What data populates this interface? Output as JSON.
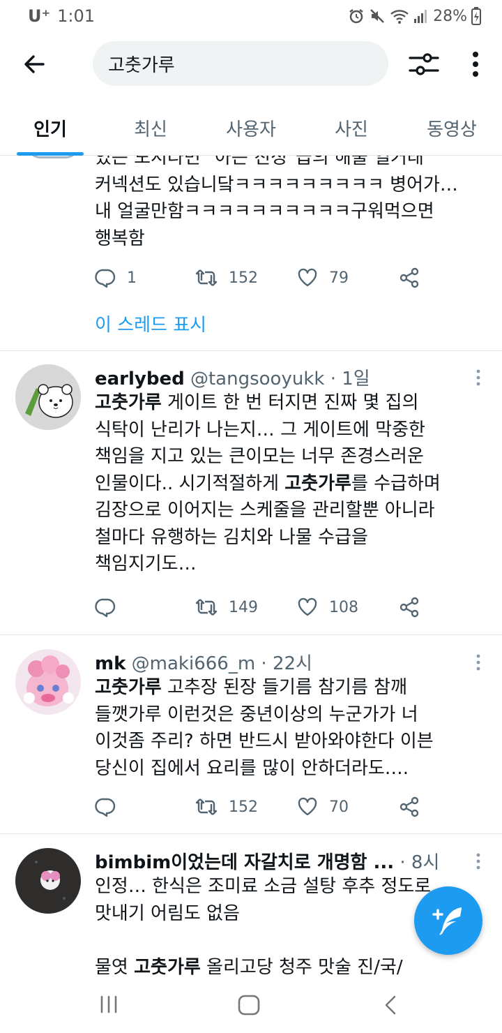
{
  "status_bar": {
    "carrier": "U⁺",
    "time": "1:01",
    "battery": "28%",
    "icons": [
      "alarm-icon",
      "mute-icon",
      "wifi-icon",
      "signal-icon",
      "battery-charging-icon"
    ]
  },
  "search": {
    "query": "고춧가루",
    "back_icon": "arrow-left-icon",
    "filter_icon": "filter-sliders-icon",
    "more_icon": "more-vertical-icon"
  },
  "tabs": [
    {
      "label": "인기",
      "active": true
    },
    {
      "label": "최신",
      "active": false
    },
    {
      "label": "사용자",
      "active": false
    },
    {
      "label": "사진",
      "active": false
    },
    {
      "label": "동영상",
      "active": false
    }
  ],
  "thread_tweet": {
    "text_lines": [
      "있는 도시라면 \"아는 친정\"급의 해물 얼거래",
      "커넥션도 있습니닼ㅋㅋㅋㅋㅋㅋㅋㅋㅋ 병어가…",
      "내 얼굴만함ㅋㅋㅋㅋㅋㅋㅋㅋㅋㅋ구워먹으면",
      "행복함"
    ],
    "replies": "1",
    "retweets": "152",
    "likes": "79",
    "show_thread": "이 스레드 표시"
  },
  "tweets": [
    {
      "name": "earlybed",
      "handle": "@tangsooyukk",
      "time": "· 1일",
      "bold1": "고춧가루",
      "text1": " 게이트 한 번 터지면 진짜 몇 집의\n식탁이 난리가 나는지… 그 게이트에 막중한\n책임을 지고 있는 큰이모는 너무 존경스러운\n인물이다.. 시기적절하게 ",
      "bold2": "고춧가루",
      "text2": "를 수급하며\n김장으로 이어지는 스케줄을 관리할뿐 아니라\n철마다 유행하는 김치와 나물 수급을\n책임지기도…",
      "retweets": "149",
      "likes": "108"
    },
    {
      "name": "mk",
      "handle": "@maki666_m",
      "time": "· 22시",
      "bold1": "고춧가루",
      "text1": " 고추장 된장 들기름 참기름 참깨\n들깻가루 이런것은 중년이상의 누군가가 너\n이것좀 주리? 하면 반드시 받아와야한다 이븐\n당신이 집에서 요리를 많이 안하더라도….",
      "retweets": "152",
      "likes": "70"
    },
    {
      "name": "bimbim이었는데 자갈치로 개명함 ...",
      "handle": "",
      "time": "· 8시",
      "text1": "인정… 한식은 조미료 소금 설탕 후추 정도로\n맛내기 어림도 없음\n\n물엿 ",
      "bold1": "고춧가루",
      "text2": " 올리고당 청주 맛술 진/국/"
    }
  ],
  "nav": [
    "recent-apps-icon",
    "home-icon",
    "back-icon"
  ],
  "colors": {
    "accent": "#1d9bf0",
    "text": "#0f1419",
    "muted": "#536471"
  }
}
